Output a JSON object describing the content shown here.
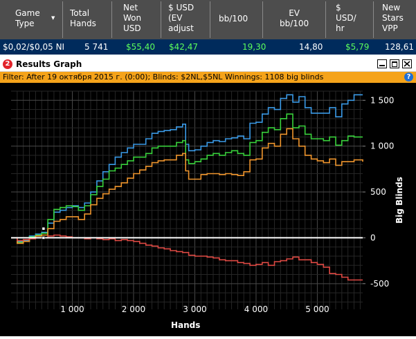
{
  "columns": [
    {
      "label": "Game\nType",
      "sort_indicator": "▼"
    },
    {
      "label": "Total\nHands"
    },
    {
      "label": "Net\nWon\nUSD"
    },
    {
      "label": "$ USD\n(EV\nadjust"
    },
    {
      "label": "bb/100"
    },
    {
      "label": "EV\nbb/100"
    },
    {
      "label": "$\nUSD/\nhr"
    },
    {
      "label": "New\nStars\nVPP"
    }
  ],
  "row": {
    "game_type": "$0,02/$0,05 NI",
    "total_hands": "5 741",
    "net_won": "$55,40",
    "ev_adjusted": "$42,47",
    "bb_100": "19,30",
    "ev_bb_100": "14,80",
    "usd_hr": "$5,79",
    "vpp": "128,61"
  },
  "window": {
    "app_icon": "2",
    "title": "Results Graph",
    "buttons": [
      "minimize-icon",
      "maximize-icon",
      "close-icon"
    ]
  },
  "filter": {
    "text": "Filter: After 19 октября 2015 г. (0:00); Blinds: $2NL,$5NL Winnings: 1108 big blinds",
    "help": "?"
  },
  "colors": {
    "header_bg": "#4d4d4d",
    "row_bg": "#002b5c",
    "positive": "#5cff5c",
    "filter_bg": "#f5a31a",
    "graph_bg": "#000000",
    "series_blue": "#3b9be8",
    "series_green": "#39d23c",
    "series_orange": "#f0962e",
    "series_red": "#e04a44",
    "zero_line": "#ffffff"
  },
  "chart_data": {
    "type": "line",
    "title": "",
    "xlabel": "Hands",
    "ylabel": "Big Blinds",
    "xlim": [
      0,
      5741
    ],
    "ylim": [
      -780,
      1600
    ],
    "x_ticks": [
      1000,
      2000,
      3000,
      4000,
      5000
    ],
    "x_tick_labels": [
      "1 000",
      "2 000",
      "3 000",
      "4 000",
      "5 000"
    ],
    "y_ticks": [
      1500,
      1000,
      500,
      0,
      -500
    ],
    "y_tick_labels": [
      "1 500",
      "1 000",
      "500",
      "0",
      "-500"
    ],
    "grid": true,
    "legend": "none",
    "series": [
      {
        "color": "#3b9be8",
        "x": [
          0,
          100,
          200,
          300,
          400,
          500,
          600,
          700,
          800,
          900,
          1000,
          1100,
          1200,
          1300,
          1400,
          1500,
          1600,
          1700,
          1800,
          1900,
          2000,
          2100,
          2200,
          2300,
          2400,
          2500,
          2600,
          2700,
          2800,
          2850,
          2900,
          3000,
          3100,
          3200,
          3300,
          3400,
          3500,
          3600,
          3700,
          3800,
          3900,
          4000,
          4100,
          4200,
          4300,
          4400,
          4500,
          4600,
          4700,
          4800,
          4900,
          5000,
          5100,
          5200,
          5300,
          5400,
          5500,
          5600,
          5741
        ],
        "y": [
          0,
          -40,
          -30,
          20,
          40,
          60,
          160,
          280,
          300,
          330,
          350,
          330,
          380,
          500,
          620,
          720,
          800,
          880,
          930,
          980,
          1020,
          1020,
          1080,
          1140,
          1160,
          1170,
          1180,
          1210,
          1240,
          1020,
          950,
          960,
          1000,
          1040,
          1060,
          1050,
          1080,
          1090,
          1110,
          1080,
          1250,
          1260,
          1350,
          1420,
          1400,
          1520,
          1560,
          1480,
          1540,
          1420,
          1360,
          1360,
          1360,
          1420,
          1320,
          1460,
          1500,
          1560,
          1560
        ]
      },
      {
        "color": "#39d23c",
        "x": [
          0,
          100,
          200,
          300,
          400,
          500,
          600,
          700,
          800,
          900,
          1000,
          1100,
          1200,
          1300,
          1400,
          1500,
          1600,
          1700,
          1800,
          1900,
          2000,
          2100,
          2200,
          2300,
          2400,
          2500,
          2600,
          2700,
          2800,
          2850,
          2900,
          3000,
          3100,
          3200,
          3300,
          3400,
          3500,
          3600,
          3700,
          3800,
          3900,
          4000,
          4100,
          4200,
          4300,
          4400,
          4500,
          4600,
          4700,
          4800,
          4900,
          5000,
          5100,
          5200,
          5300,
          5400,
          5500,
          5600,
          5741
        ],
        "y": [
          0,
          -50,
          -40,
          10,
          30,
          50,
          200,
          310,
          330,
          350,
          340,
          300,
          350,
          470,
          560,
          640,
          730,
          760,
          800,
          840,
          880,
          880,
          920,
          980,
          1000,
          1000,
          1000,
          1040,
          1060,
          850,
          810,
          830,
          860,
          900,
          920,
          900,
          930,
          950,
          920,
          900,
          1040,
          1060,
          1150,
          1200,
          1180,
          1300,
          1350,
          1200,
          1220,
          1130,
          1080,
          1080,
          1060,
          1100,
          1010,
          1060,
          1110,
          1100,
          1100
        ]
      },
      {
        "color": "#f0962e",
        "x": [
          0,
          100,
          200,
          300,
          400,
          500,
          600,
          700,
          800,
          900,
          1000,
          1100,
          1200,
          1300,
          1400,
          1500,
          1600,
          1700,
          1800,
          1900,
          2000,
          2100,
          2200,
          2300,
          2400,
          2500,
          2600,
          2700,
          2800,
          2850,
          2900,
          3000,
          3100,
          3200,
          3300,
          3400,
          3500,
          3600,
          3700,
          3800,
          3900,
          4000,
          4100,
          4200,
          4300,
          4400,
          4500,
          4600,
          4700,
          4800,
          4900,
          5000,
          5100,
          5200,
          5300,
          5400,
          5500,
          5600,
          5741
        ],
        "y": [
          0,
          -60,
          -40,
          0,
          20,
          30,
          100,
          180,
          200,
          230,
          230,
          200,
          260,
          360,
          430,
          480,
          530,
          560,
          600,
          650,
          700,
          740,
          780,
          820,
          840,
          850,
          850,
          900,
          920,
          730,
          640,
          640,
          690,
          700,
          700,
          690,
          700,
          690,
          680,
          720,
          850,
          860,
          980,
          1030,
          1000,
          1130,
          1190,
          1080,
          1000,
          900,
          860,
          840,
          820,
          860,
          790,
          830,
          830,
          850,
          830
        ]
      },
      {
        "color": "#e04a44",
        "x": [
          0,
          100,
          200,
          300,
          400,
          500,
          600,
          700,
          800,
          900,
          1000,
          1100,
          1200,
          1300,
          1400,
          1500,
          1600,
          1700,
          1800,
          1900,
          2000,
          2100,
          2200,
          2300,
          2400,
          2500,
          2600,
          2700,
          2800,
          2900,
          3000,
          3100,
          3200,
          3300,
          3400,
          3500,
          3600,
          3700,
          3800,
          3900,
          4000,
          4100,
          4200,
          4300,
          4400,
          4500,
          4600,
          4700,
          4800,
          4900,
          5000,
          5100,
          5200,
          5300,
          5400,
          5500,
          5600,
          5741
        ],
        "y": [
          0,
          -30,
          -20,
          -10,
          0,
          0,
          20,
          30,
          20,
          10,
          0,
          0,
          -10,
          0,
          -10,
          -20,
          -10,
          -30,
          -20,
          -30,
          -40,
          -60,
          -80,
          -90,
          -110,
          -120,
          -140,
          -150,
          -160,
          -190,
          -200,
          -200,
          -210,
          -220,
          -240,
          -250,
          -250,
          -270,
          -280,
          -300,
          -290,
          -270,
          -300,
          -260,
          -250,
          -230,
          -210,
          -240,
          -240,
          -270,
          -290,
          -320,
          -390,
          -400,
          -430,
          -460,
          -460,
          -460
        ]
      }
    ],
    "markers": [
      {
        "x": 530,
        "y": 100,
        "color": "#ffffff"
      },
      {
        "x": 530,
        "y": 0,
        "color": "#ffffff"
      }
    ]
  }
}
